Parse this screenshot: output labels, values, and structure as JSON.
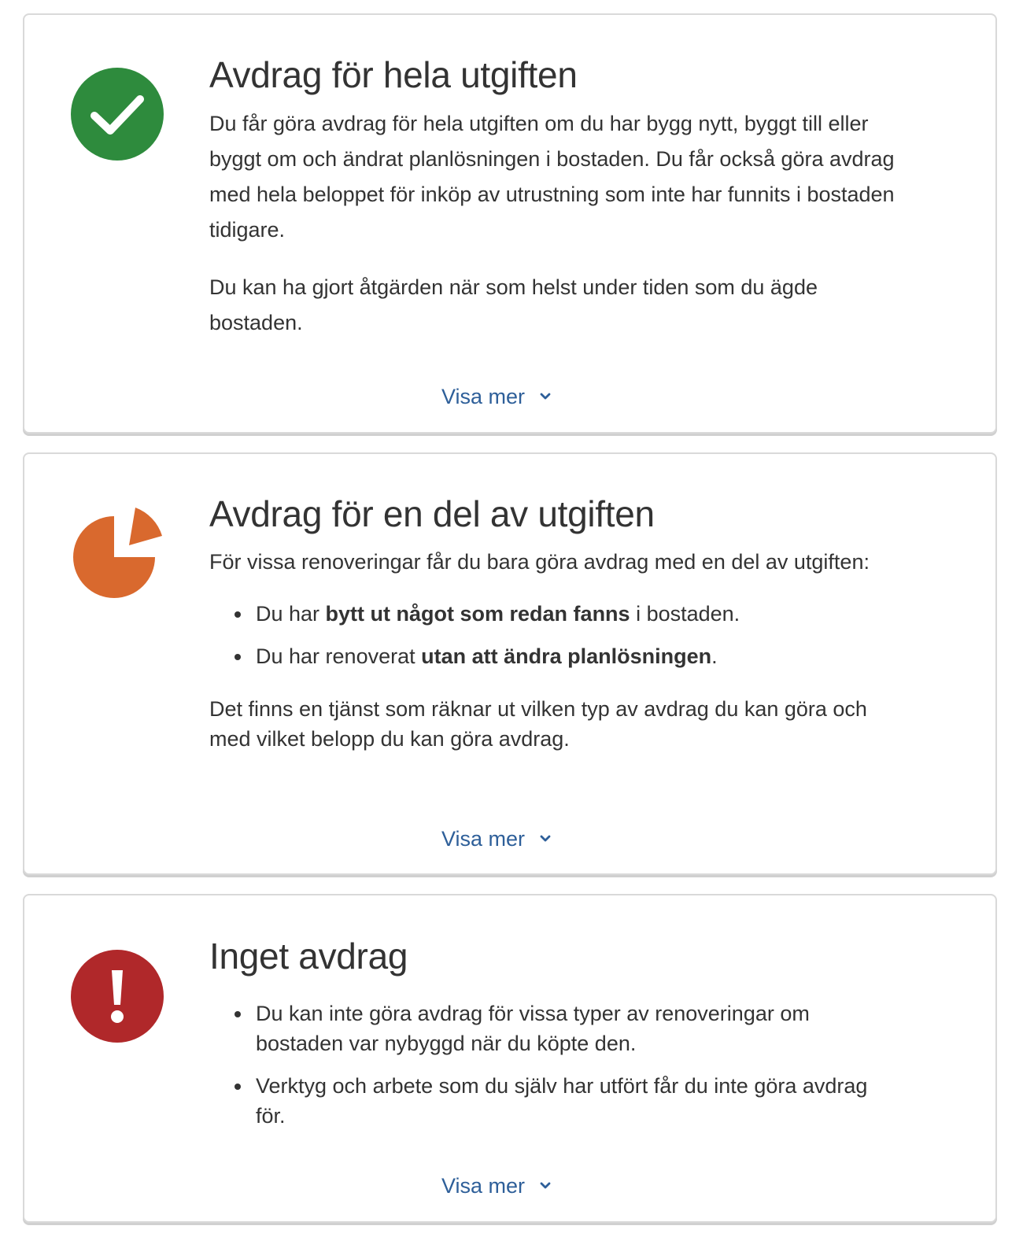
{
  "cards": [
    {
      "icon": "check-circle-icon",
      "icon_color": "#2e8b3d",
      "title": "Avdrag för hela utgiften",
      "paragraphs": [
        "Du får göra avdrag för hela utgiften om du har bygg nytt, byggt till eller byggt om och ändrat planlösningen i bostaden. Du får också göra avdrag med hela beloppet för inköp av utrustning som inte har funnits i bostaden tidigare.",
        "Du kan ha gjort åtgärden när som helst under tiden som du ägde bostaden."
      ],
      "toggle_label": "Visa mer"
    },
    {
      "icon": "pie-chart-icon",
      "icon_color": "#d9692e",
      "title": "Avdrag för en del av utgiften",
      "intro": "För vissa renoveringar får du bara göra avdrag med en del av utgiften:",
      "bullets": [
        {
          "before": "Du har ",
          "bold": "bytt ut något som redan fanns",
          "after": " i bostaden."
        },
        {
          "before": "Du har renoverat ",
          "bold": "utan att ändra planlösningen",
          "after": "."
        }
      ],
      "outro": "Det finns en tjänst som räknar ut vilken typ av avdrag du kan göra och med vilket belopp du kan göra avdrag.",
      "toggle_label": "Visa mer"
    },
    {
      "icon": "exclamation-circle-icon",
      "icon_color": "#b0282a",
      "title": "Inget avdrag",
      "bullets": [
        "Du kan inte göra avdrag för vissa typer av renoveringar om bostaden var nybyggd när du köpte den.",
        "Verktyg och arbete som du själv har utfört får du inte göra avdrag för."
      ],
      "toggle_label": "Visa mer"
    }
  ],
  "colors": {
    "link": "#2e5f99",
    "text": "#333333",
    "border": "#d9d9d9"
  }
}
